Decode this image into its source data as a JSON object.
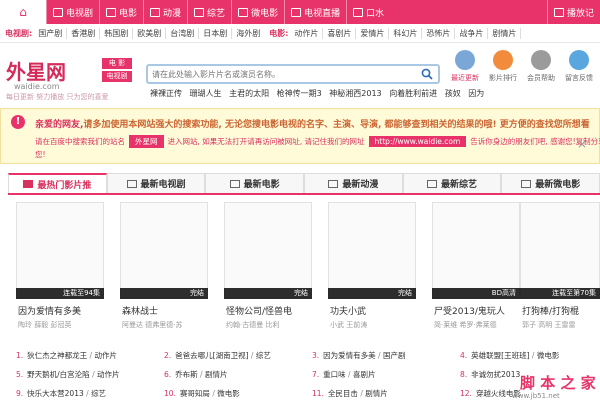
{
  "topnav": {
    "items": [
      "电视剧",
      "电影",
      "动漫",
      "综艺",
      "微电影",
      "电视直播",
      "口水",
      "播放记"
    ]
  },
  "subnav": {
    "tv_label": "电视剧:",
    "tv": [
      "国产剧",
      "香港剧",
      "韩国剧",
      "欧美剧",
      "台湾剧",
      "日本剧",
      "海外剧"
    ],
    "movie_label": "电影:",
    "movie": [
      "动作片",
      "喜剧片",
      "爱情片",
      "科幻片",
      "恐怖片",
      "战争片",
      "剧情片"
    ]
  },
  "logo": {
    "text": "外星网",
    "domain": "waidie.com",
    "tag1": "电 影",
    "tag2": "电视剧",
    "slogan": "每日更新 努力播放 只为您的喜爱"
  },
  "search": {
    "placeholder": "请在此处输入影片片名或演员名称。"
  },
  "hot": [
    "裸祼正传",
    "珊瑚人生",
    "主君的太阳",
    "枪神传一期3",
    "神秘湘西2013",
    "向着胜利前进",
    "孩奴",
    "因为"
  ],
  "quicklinks": [
    "最近更新",
    "影片排行",
    "会员帮助",
    "留言反馈"
  ],
  "notice": {
    "line1_prefix": "亲爱的网友,",
    "line1": "请多加使用本网站强大的搜索功能, 无论您搜电影电视的名字、主演、导演, 都能够查到相关的结果的哦! 更方便的查找您所想看",
    "line2_a": "请在百度中搜索我们的站名",
    "line2_box": "外星网",
    "line2_b": "进入网站, 如果无法打开请再访问被网址, 请记住我们的网址",
    "line2_url": "http://www.waidie.com",
    "line2_c": "告诉你身边的朋友们吧, 感谢您!",
    "line2_d": "复制分享给",
    "line3": "您!"
  },
  "tabs": [
    "最热门影片推",
    "最新电视剧",
    "最新电影",
    "最新动漫",
    "最新综艺",
    "最新微电影"
  ],
  "movies": [
    {
      "status": "连载至94集",
      "title": "因为爱情有多美",
      "cast": "陶玲 薛毅 彭冠英"
    },
    {
      "status": "完结",
      "title": "森林战士",
      "cast": "阿曼达 德弗里德·苏"
    },
    {
      "status": "完结",
      "title": "怪物公司/怪兽电",
      "cast": "约翰·古德曼 比利"
    },
    {
      "status": "完结",
      "title": "功夫小武",
      "cast": "小武 王前涛"
    },
    {
      "status": "BD高清",
      "title": "尸受2013/鬼玩人",
      "cast": "简·莱维 希罗·弗莱德"
    },
    {
      "status": "连载至第70集",
      "title": "打狗棒/打狗棍",
      "cast": "郭子 高明 王雷雷"
    }
  ],
  "list": [
    {
      "n": "1.",
      "t": "狄仁杰之神都龙王",
      "c": "动作片"
    },
    {
      "n": "2.",
      "t": "爸爸去哪儿[湖南卫视]",
      "c": "综艺"
    },
    {
      "n": "3.",
      "t": "因为爱情有多美",
      "c": "国产剧"
    },
    {
      "n": "4.",
      "t": "英雄联盟[王班班]",
      "c": "微电影"
    },
    {
      "n": "5.",
      "t": "野天鹅机/白宫沦陷",
      "c": "动作片"
    },
    {
      "n": "6.",
      "t": "乔布斯",
      "c": "剧情片"
    },
    {
      "n": "7.",
      "t": "重口味",
      "c": "喜剧片"
    },
    {
      "n": "8.",
      "t": "非诚勿扰2013",
      "c": ""
    },
    {
      "n": "9.",
      "t": "快乐大本营2013",
      "c": "综艺"
    },
    {
      "n": "10.",
      "t": "赛哥知局",
      "c": "微电影"
    },
    {
      "n": "11.",
      "t": "全民目击",
      "c": "剧情片"
    },
    {
      "n": "12.",
      "t": "穿越火线电影",
      "c": ""
    }
  ],
  "watermark": {
    "big": "脚 本 之 家",
    "small": "www.jb51.net"
  }
}
